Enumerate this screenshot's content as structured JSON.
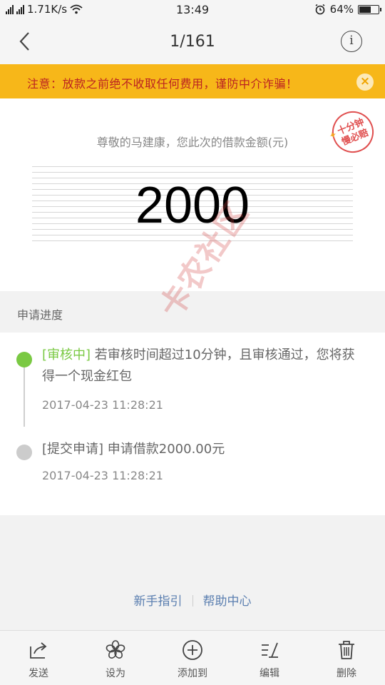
{
  "status_bar": {
    "left_text": "1.71K/s",
    "time": "13:49",
    "battery": "64%",
    "battery_level": 0.64,
    "icons": [
      "signal-icon",
      "signal-icon",
      "wifi-icon",
      "alarm-icon",
      "battery-icon"
    ]
  },
  "nav": {
    "title": "1/161",
    "back_icon": "chevron-left-icon",
    "info_icon": "info-icon"
  },
  "notice": {
    "text": "注意：放款之前绝不收取任何费用，谨防中介诈骗！",
    "close_icon": "close-icon"
  },
  "amount": {
    "caption": "尊敬的马建康，您此次的借款金额(元)",
    "value": "2000",
    "stamp_text": "十分钟 慢必赔"
  },
  "progress": {
    "section_label": "申请进度",
    "steps": [
      {
        "tag": "[审核中]",
        "text": " 若审核时间超过10分钟，且审核通过，您将获得一个现金红包",
        "time": "2017-04-23 11:28:21",
        "status_color": "#7ac943"
      },
      {
        "tag": "[提交申请]",
        "text": " 申请借款2000.00元",
        "time": "2017-04-23 11:28:21",
        "status_color": "#cccccc"
      }
    ]
  },
  "links": {
    "guide": "新手指引",
    "help": "帮助中心"
  },
  "toolbar": {
    "items": [
      {
        "label": "发送",
        "icon": "share-icon"
      },
      {
        "label": "设为",
        "icon": "flower-icon"
      },
      {
        "label": "添加到",
        "icon": "add-circle-icon"
      },
      {
        "label": "编辑",
        "icon": "edit-icon"
      },
      {
        "label": "删除",
        "icon": "trash-icon"
      }
    ]
  },
  "watermark": "卡农社区",
  "colors": {
    "notice_bg": "#f7b719",
    "notice_text": "#b22222",
    "accent_green": "#7ac943",
    "link_blue": "#5b7fb0"
  }
}
